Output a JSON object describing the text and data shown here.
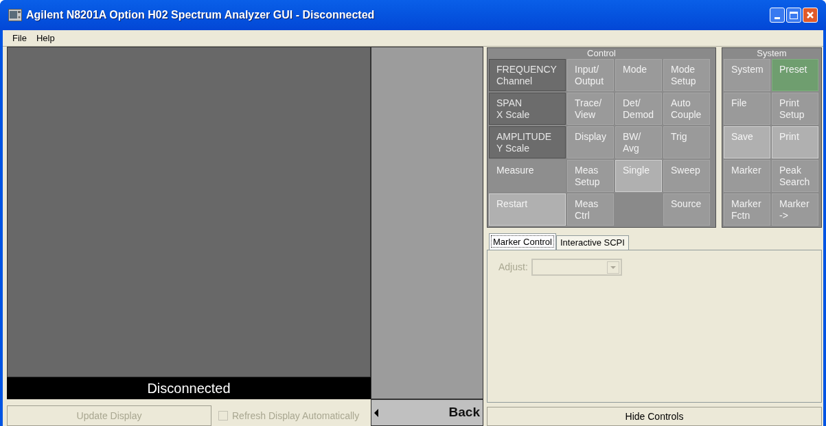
{
  "window": {
    "title": "Agilent N8201A Option H02 Spectrum Analyzer GUI - Disconnected"
  },
  "menu": [
    {
      "label": "File"
    },
    {
      "label": "Help"
    }
  ],
  "display": {
    "status": "Disconnected"
  },
  "update_button": {
    "label": "Update Display",
    "disabled": true
  },
  "refresh_checkbox": {
    "label": "Refresh Display Automatically",
    "checked": false,
    "disabled": true
  },
  "back_button": {
    "label": "Back"
  },
  "control": {
    "title": "Control",
    "keys": [
      {
        "kind": "dark",
        "lines": [
          "FREQUENCY",
          "Channel"
        ]
      },
      {
        "kind": "normal",
        "lines": [
          "Input/",
          "Output"
        ]
      },
      {
        "kind": "normal",
        "lines": [
          "Mode"
        ]
      },
      {
        "kind": "normal",
        "lines": [
          "Mode",
          "Setup"
        ]
      },
      {
        "kind": "dark",
        "lines": [
          "SPAN",
          "X Scale"
        ]
      },
      {
        "kind": "normal",
        "lines": [
          "Trace/",
          "View"
        ]
      },
      {
        "kind": "normal",
        "lines": [
          "Det/",
          "Demod"
        ]
      },
      {
        "kind": "normal",
        "lines": [
          "Auto",
          "Couple"
        ]
      },
      {
        "kind": "dark",
        "lines": [
          "AMPLITUDE",
          "Y Scale"
        ]
      },
      {
        "kind": "normal",
        "lines": [
          "Display"
        ]
      },
      {
        "kind": "normal",
        "lines": [
          "BW/",
          "Avg"
        ]
      },
      {
        "kind": "normal",
        "lines": [
          "Trig"
        ]
      },
      {
        "kind": "flat",
        "lines": [
          "Measure"
        ]
      },
      {
        "kind": "normal",
        "lines": [
          "Meas",
          "Setup"
        ]
      },
      {
        "kind": "light",
        "lines": [
          "Single"
        ]
      },
      {
        "kind": "normal",
        "lines": [
          "Sweep"
        ]
      },
      {
        "kind": "light",
        "lines": [
          "Restart"
        ]
      },
      {
        "kind": "normal",
        "lines": [
          "Meas",
          "Ctrl"
        ]
      },
      {
        "kind": "blank"
      },
      {
        "kind": "normal",
        "lines": [
          "Source"
        ]
      }
    ]
  },
  "system": {
    "title": "System",
    "keys": [
      {
        "kind": "normal",
        "lines": [
          "System"
        ]
      },
      {
        "kind": "green",
        "lines": [
          "Preset"
        ]
      },
      {
        "kind": "normal",
        "lines": [
          "File"
        ]
      },
      {
        "kind": "normal",
        "lines": [
          "Print",
          "Setup"
        ]
      },
      {
        "kind": "light",
        "lines": [
          "Save"
        ]
      },
      {
        "kind": "light",
        "lines": [
          "Print"
        ]
      },
      {
        "kind": "normal",
        "lines": [
          "Marker"
        ]
      },
      {
        "kind": "normal",
        "lines": [
          "Peak",
          "Search"
        ]
      },
      {
        "kind": "normal",
        "lines": [
          "Marker",
          "Fctn"
        ]
      },
      {
        "kind": "normal",
        "lines": [
          "Marker",
          "->"
        ]
      }
    ]
  },
  "tabs": [
    {
      "label": "Marker Control",
      "selected": true
    },
    {
      "label": "Interactive SCPI",
      "selected": false
    }
  ],
  "adjust": {
    "label": "Adjust:",
    "disabled": true
  },
  "hide_controls_button": {
    "label": "Hide Controls"
  }
}
